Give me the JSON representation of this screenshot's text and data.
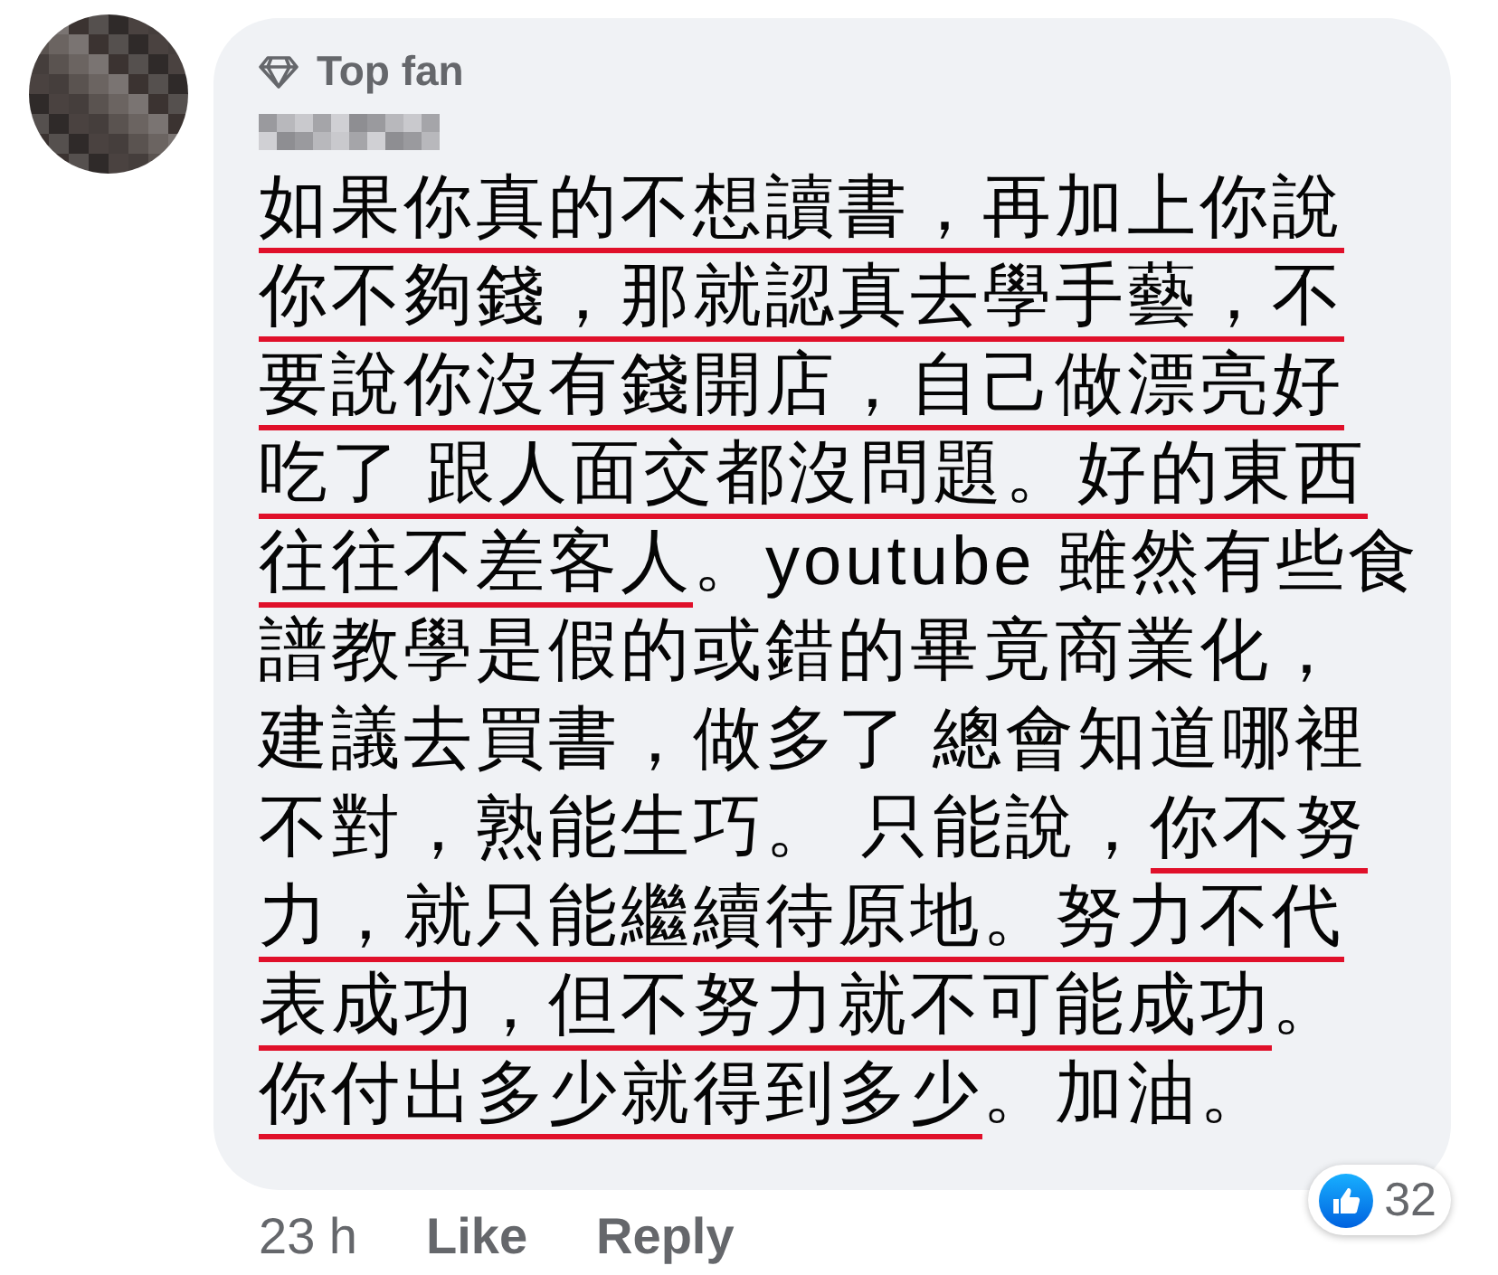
{
  "comment": {
    "badge": "Top fan",
    "lines": [
      {
        "segments": [
          {
            "text": "如果你真的不想讀書，再加上你說",
            "underlined": true
          }
        ]
      },
      {
        "segments": [
          {
            "text": "你不夠錢，那就認真去學手藝，不",
            "underlined": true
          }
        ]
      },
      {
        "segments": [
          {
            "text": "要說你沒有錢開店，自己做漂亮好",
            "underlined": true
          }
        ]
      },
      {
        "segments": [
          {
            "text": "吃了 跟人面交都沒問題。好的東西",
            "underlined": true
          }
        ]
      },
      {
        "segments": [
          {
            "text": "往往不差客人",
            "underlined": true
          },
          {
            "text": "。youtube 雖然有些食",
            "underlined": false
          }
        ]
      },
      {
        "segments": [
          {
            "text": "譜教學是假的或錯的畢竟商業化，",
            "underlined": false
          }
        ]
      },
      {
        "segments": [
          {
            "text": "建議去買書，做多了 總會知道哪裡",
            "underlined": false
          }
        ]
      },
      {
        "segments": [
          {
            "text": "不對，熟能生巧。 只能說，",
            "underlined": false
          },
          {
            "text": "你不努",
            "underlined": true
          }
        ]
      },
      {
        "segments": [
          {
            "text": "力，就只能繼續待原地。努力不代",
            "underlined": true
          }
        ]
      },
      {
        "segments": [
          {
            "text": "表成功，但不努力就不可能成功",
            "underlined": true
          },
          {
            "text": "。",
            "underlined": false
          }
        ]
      },
      {
        "segments": [
          {
            "text": "你付出多少就得到多少",
            "underlined": true
          },
          {
            "text": "。加油。",
            "underlined": false
          }
        ]
      }
    ],
    "time": "23 h",
    "actions": [
      "Like",
      "Reply"
    ],
    "reaction_count": "32"
  }
}
